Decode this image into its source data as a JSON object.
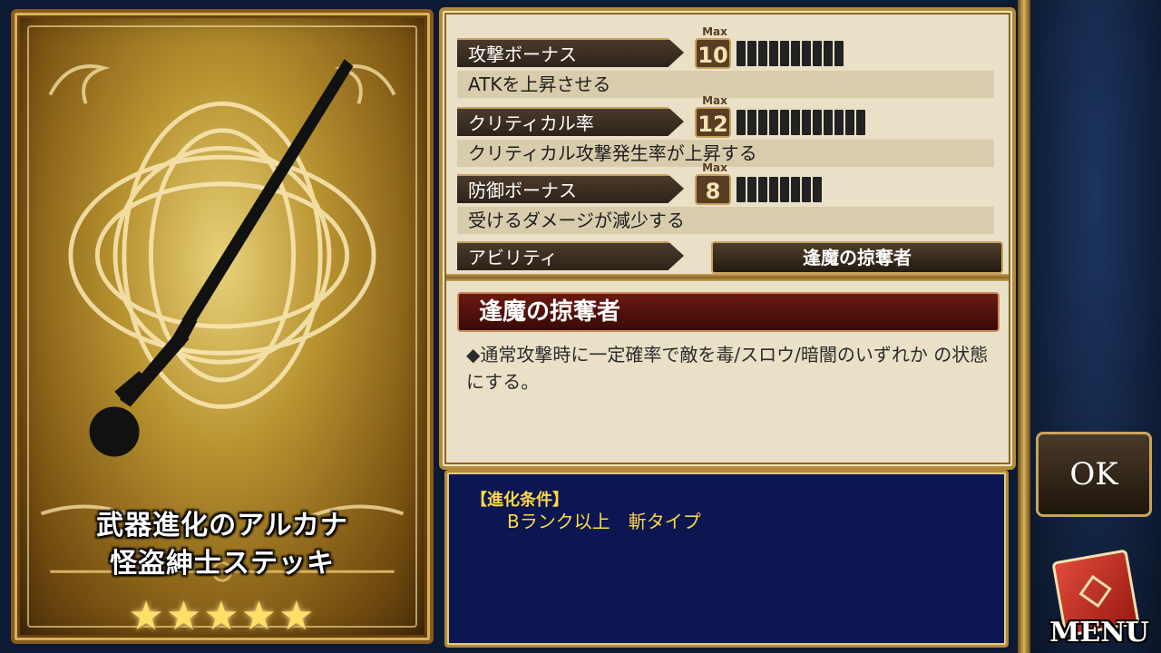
{
  "card": {
    "name_line1": "武器進化のアルカナ",
    "name_line2": "怪盗紳士ステッキ",
    "stars": "★★★★★",
    "rarity": 5,
    "art_icon": "cane-icon"
  },
  "stats": [
    {
      "label": "攻撃ボーナス",
      "max_tag": "Max",
      "max": "10",
      "pips": 10,
      "description": "ATKを上昇させる"
    },
    {
      "label": "クリティカル率",
      "max_tag": "Max",
      "max": "12",
      "pips": 12,
      "description": "クリティカル攻撃発生率が上昇する"
    },
    {
      "label": "防御ボーナス",
      "max_tag": "Max",
      "max": "8",
      "pips": 8,
      "description": "受けるダメージが減少する"
    }
  ],
  "ability": {
    "label": "アビリティ",
    "button": "逢魔の掠奪者",
    "title": "逢魔の掠奪者",
    "description": "◆通常攻撃時に一定確率で敵を毒/スロウ/暗闇のいずれか の状態にする。"
  },
  "evolution": {
    "heading": "【進化条件】",
    "condition": "Bランク以上　斬タイプ"
  },
  "side": {
    "ok_label": "OK",
    "menu_label": "MENU",
    "menu_icon": "book-icon"
  },
  "colors": {
    "gold": "#c9a45c",
    "condition_text": "#ffd84a",
    "condition_bg": "#0c1650",
    "ability_title_bg": "#6a1a12"
  }
}
